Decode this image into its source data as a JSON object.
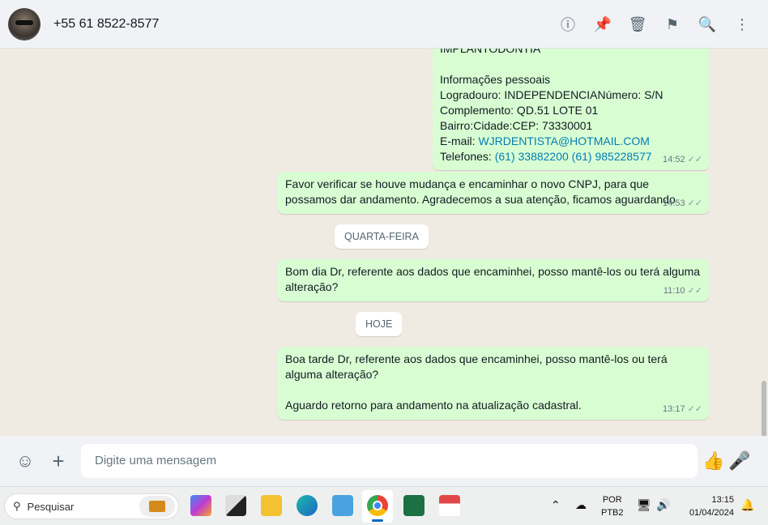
{
  "header": {
    "contact": "+55 61 8522-8577",
    "icons": [
      "info-icon",
      "pin-icon",
      "delete-icon",
      "label-icon",
      "search-icon",
      "menu-icon"
    ]
  },
  "messages": [
    {
      "lines": [
        "IMPLANTODONTIA",
        "",
        "Informações pessoais",
        "Logradouro: INDEPENDENCIANúmero: S/N",
        "Complemento: QD.51 LOTE 01",
        "Bairro:Cidade:CEP: 73330001"
      ],
      "email_label": "E-mail: ",
      "email": "WJRDENTISTA@HOTMAIL.COM",
      "phone_label": "Telefones: ",
      "phones": "(61) 33882200 (61) 985228577",
      "time": "14:52"
    },
    {
      "text": "Favor verificar se houve mudança e encaminhar o novo CNPJ, para que possamos dar andamento. Agradecemos a sua atenção, ficamos aguardando",
      "time": "14:53"
    },
    {
      "text": "Bom dia Dr, referente aos dados que encaminhei, posso mantê-los ou terá alguma alteração?",
      "time": "11:10"
    },
    {
      "text": "Boa tarde Dr, referente aos dados que encaminhei, posso mantê-los ou terá alguma alteração?",
      "text2": "Aguardo retorno para andamento na atualização cadastral.",
      "time": "13:17"
    }
  ],
  "day_chips": [
    "QUARTA-FEIRA",
    "HOJE"
  ],
  "composer": {
    "placeholder": "Digite uma mensagem"
  },
  "taskbar": {
    "search": "Pesquisar",
    "lang1": "POR",
    "lang2": "PTB2",
    "time": "13:15",
    "date": "01/04/2024"
  }
}
